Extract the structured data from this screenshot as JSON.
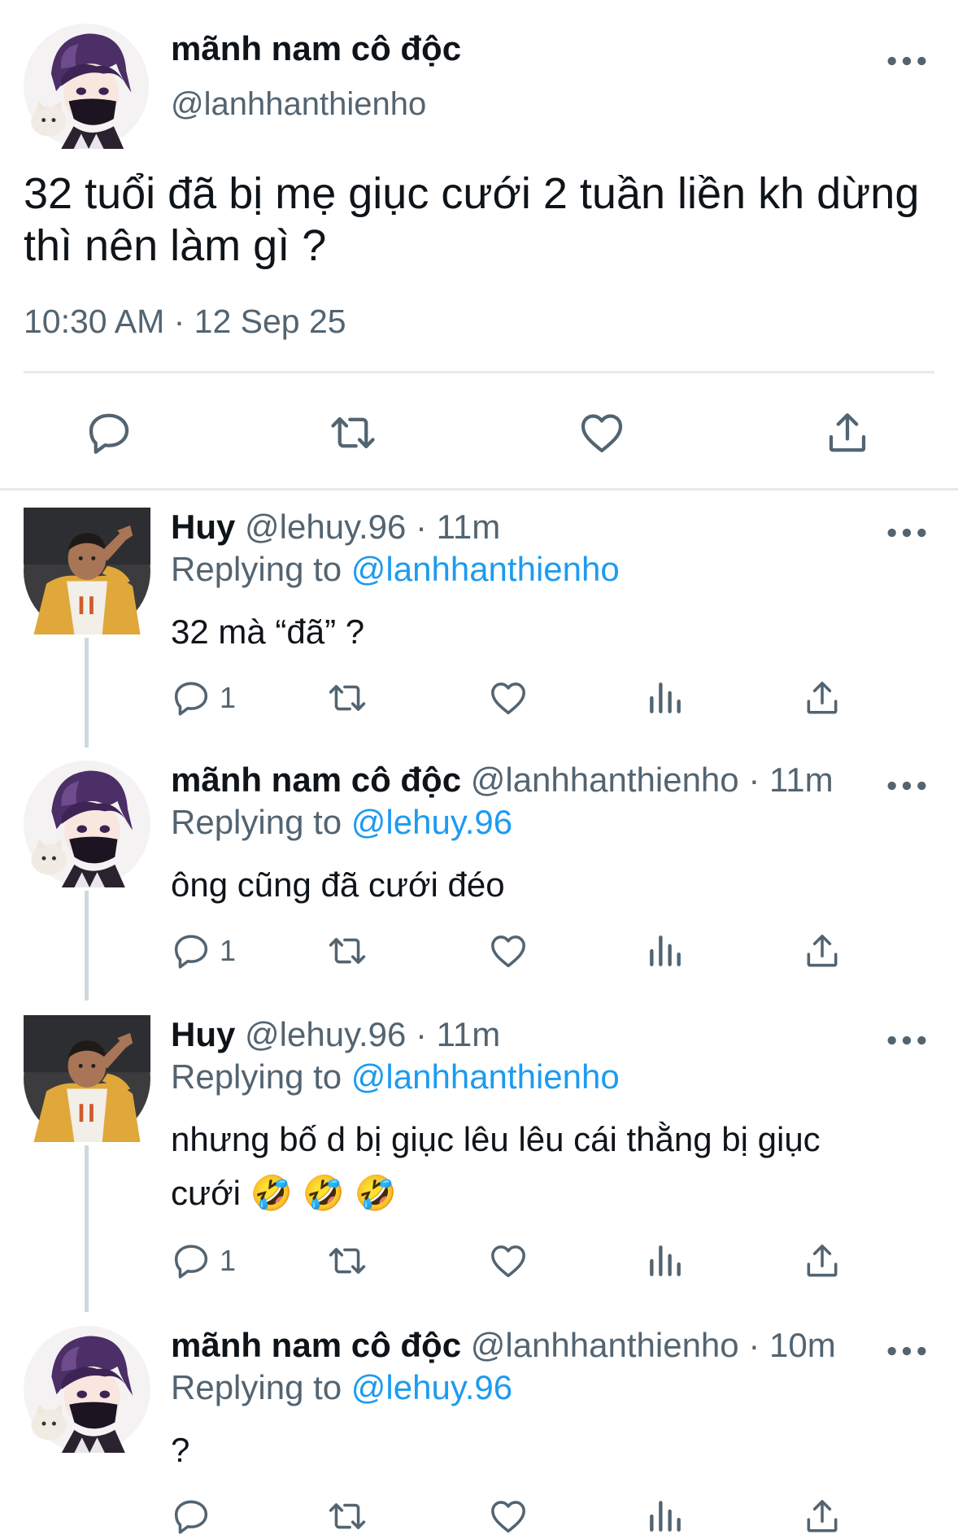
{
  "main_tweet": {
    "display_name": "mãnh nam cô độc",
    "handle": "@lanhhanthienho",
    "text": "32 tuổi đã bị mẹ giục cưới 2 tuần liền kh dừng thì nên làm gì ?",
    "timestamp": "10:30 AM · 12 Sep 25"
  },
  "replies": [
    {
      "display_name": "Huy",
      "handle": "@lehuy.96",
      "time": "· 11m",
      "replying_prefix": "Replying to ",
      "replying_to": "@lanhhanthienho",
      "text": "32 mà “đã” ?",
      "reply_count": "1"
    },
    {
      "display_name": "mãnh nam cô độc",
      "handle": "@lanhhanthienho",
      "time": "· 11m",
      "replying_prefix": "Replying to ",
      "replying_to": "@lehuy.96",
      "text": "ông cũng đã cưới đéo",
      "reply_count": "1"
    },
    {
      "display_name": "Huy",
      "handle": "@lehuy.96",
      "time": "· 11m",
      "replying_prefix": "Replying to ",
      "replying_to": "@lanhhanthienho",
      "text": "nhưng bố d bị giục lêu lêu cái thằng bị giục cưới 🤣 🤣 🤣",
      "reply_count": "1"
    },
    {
      "display_name": "mãnh nam cô độc",
      "handle": "@lanhhanthienho",
      "time": "· 10m",
      "replying_prefix": "Replying to ",
      "replying_to": "@lehuy.96",
      "text": "?",
      "reply_count": ""
    }
  ],
  "icons": {
    "reply": "reply-icon",
    "retweet": "retweet-icon",
    "like": "heart-icon",
    "share": "share-icon",
    "views": "views-icon",
    "more": "more-icon"
  },
  "colors": {
    "text": "#0f1419",
    "secondary": "#536471",
    "link": "#1d9bf0",
    "divider": "#e7e9ec"
  }
}
